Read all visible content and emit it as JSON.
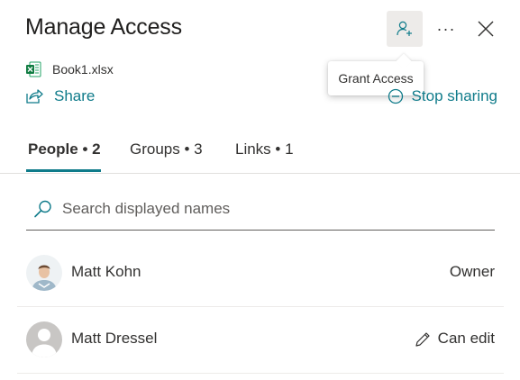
{
  "panel": {
    "title": "Manage Access",
    "grant_tooltip": "Grant Access",
    "more_label": "···",
    "file_name": "Book1.xlsx",
    "share_label": "Share",
    "stop_sharing_label": "Stop sharing",
    "accent_color": "#0f7b8a"
  },
  "tabs": [
    {
      "label": "People • 2",
      "active": true
    },
    {
      "label": "Groups • 3",
      "active": false
    },
    {
      "label": "Links • 1",
      "active": false
    }
  ],
  "search": {
    "placeholder": "Search displayed names"
  },
  "people": [
    {
      "name": "Matt Kohn",
      "role": "Owner",
      "avatar": "photo"
    },
    {
      "name": "Matt Dressel",
      "role": "Can edit",
      "avatar": "default-silhouette"
    }
  ]
}
